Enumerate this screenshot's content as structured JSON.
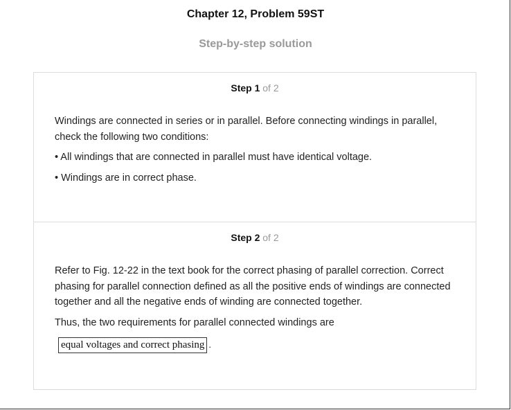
{
  "header": {
    "title": "Chapter 12, Problem 59ST",
    "subtitle": "Step-by-step solution"
  },
  "steps": [
    {
      "label": "Step 1",
      "of_text": "of 2",
      "paragraphs": [
        "Windings are connected in series or in parallel. Before connecting windings in parallel, check the following two conditions:"
      ],
      "bullets": [
        "• All windings that are connected in parallel must have identical voltage.",
        "• Windings are in correct phase."
      ]
    },
    {
      "label": "Step 2",
      "of_text": "of 2",
      "paragraphs": [
        "Refer to Fig. 12-22 in the text book for the correct phasing of parallel correction. Correct phasing for parallel connection defined as all the positive ends of windings are connected together and all the negative ends of winding are connected together.",
        "Thus, the two requirements for parallel connected windings are"
      ],
      "answer": "equal voltages and correct phasing",
      "answer_suffix": "."
    }
  ]
}
